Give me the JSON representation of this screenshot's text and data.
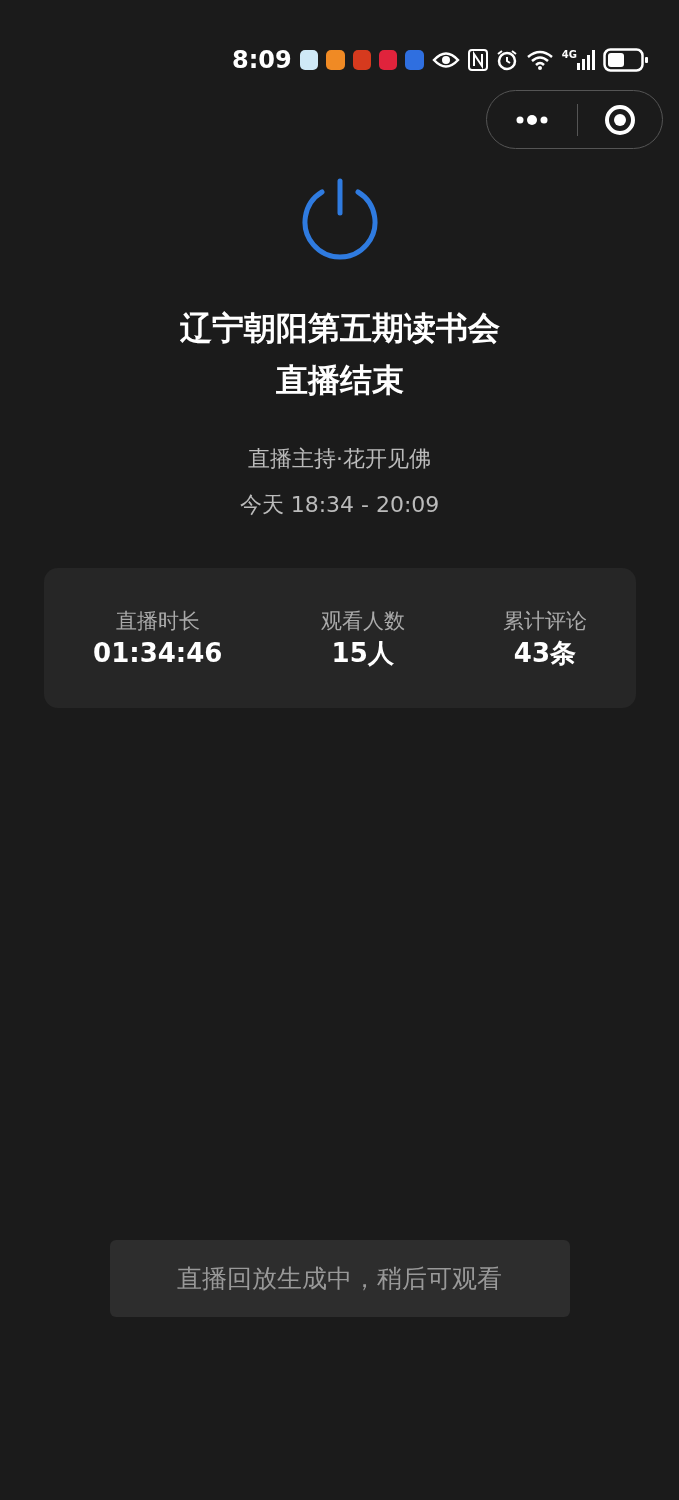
{
  "status_bar": {
    "time": "8:09",
    "network": "4G"
  },
  "title": "辽宁朝阳第五期读书会",
  "subtitle": "直播结束",
  "host": "直播主持·花开见佛",
  "time_range": "今天 18:34 - 20:09",
  "stats": [
    {
      "label": "直播时长",
      "value": "01:34:46"
    },
    {
      "label": "观看人数",
      "value": "15人"
    },
    {
      "label": "累计评论",
      "value": "43条"
    }
  ],
  "toast": "直播回放生成中，稍后可观看"
}
